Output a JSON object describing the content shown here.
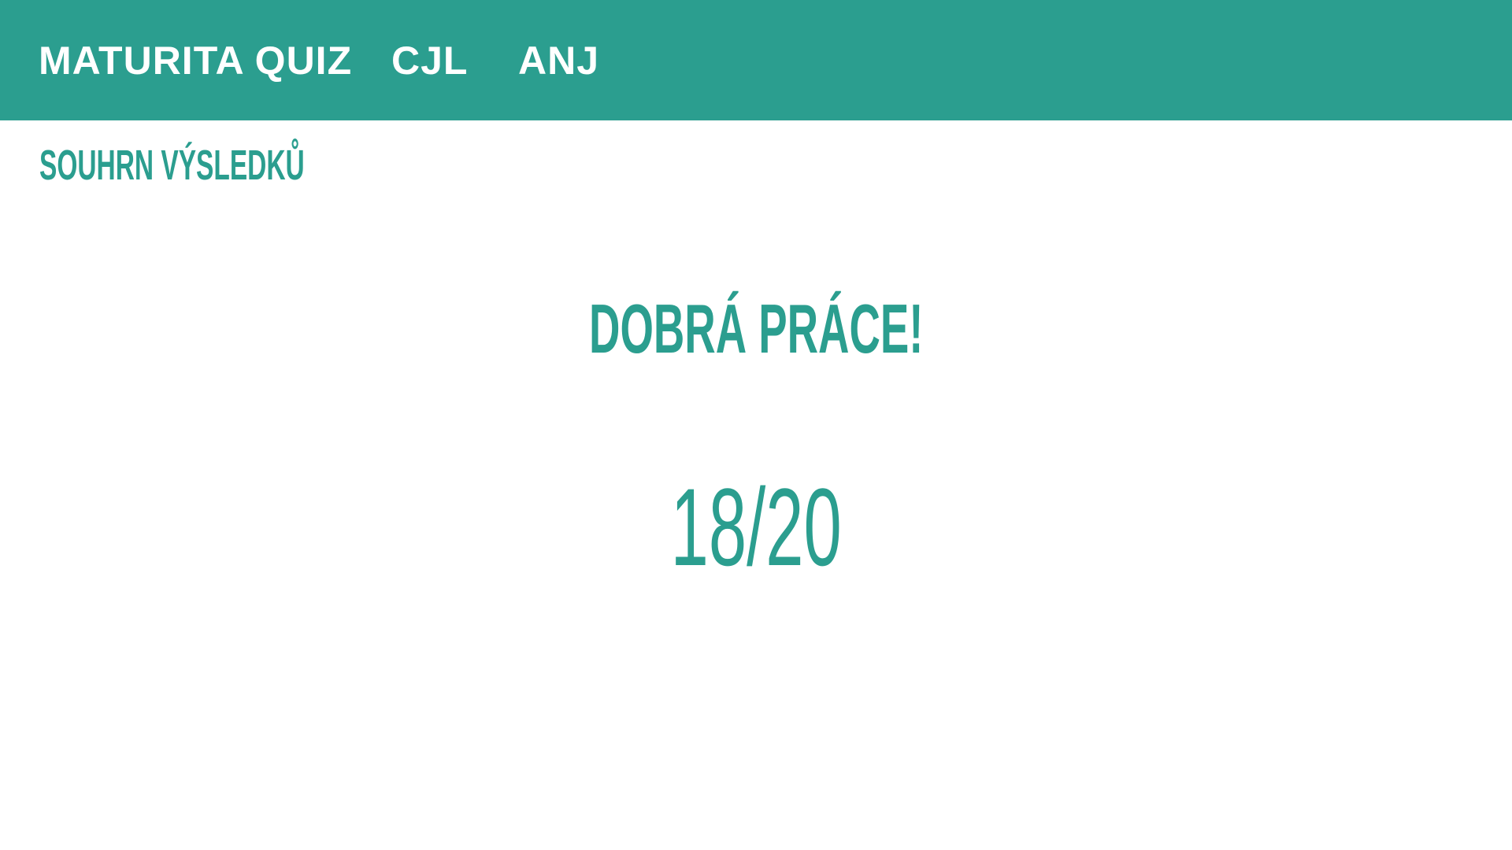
{
  "nav": {
    "brand": "MATURITA QUIZ",
    "links": [
      "CJL",
      "ANJ"
    ]
  },
  "page": {
    "subtitle": "SOUHRN VÝSLEDKŮ",
    "headline": "DOBRÁ PRÁCE!",
    "score": "18/20"
  },
  "colors": {
    "accent": "#2b9e8f",
    "nav_text": "#ffffff",
    "background": "#ffffff"
  }
}
